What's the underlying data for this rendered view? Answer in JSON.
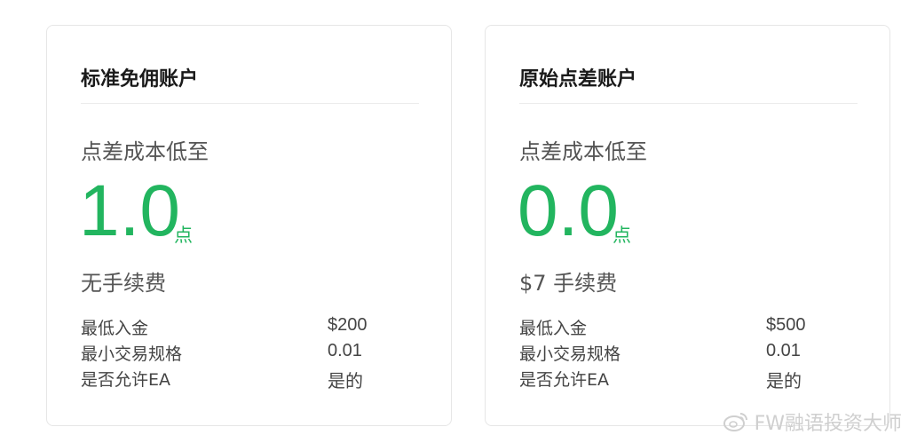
{
  "cards": [
    {
      "title": "标准免佣账户",
      "spread_label": "点差成本低至",
      "spread_value": "1.0",
      "spread_unit": "点",
      "fee": "无手续费",
      "specs": [
        {
          "label": "最低入金",
          "value": "$200"
        },
        {
          "label": "最小交易规格",
          "value": "0.01"
        },
        {
          "label": "是否允许EA",
          "value": "是的"
        }
      ]
    },
    {
      "title": "原始点差账户",
      "spread_label": "点差成本低至",
      "spread_value": "0.0",
      "spread_unit": "点",
      "fee": "$7 手续费",
      "specs": [
        {
          "label": "最低入金",
          "value": "$500"
        },
        {
          "label": "最小交易规格",
          "value": "0.01"
        },
        {
          "label": "是否允许EA",
          "value": "是的"
        }
      ]
    }
  ],
  "watermark": {
    "text": "FW融语投资大师",
    "icon": "weibo-icon"
  },
  "colors": {
    "accent": "#22b55f",
    "border": "#e6e6e6",
    "watermark": "#cfcfcf"
  }
}
